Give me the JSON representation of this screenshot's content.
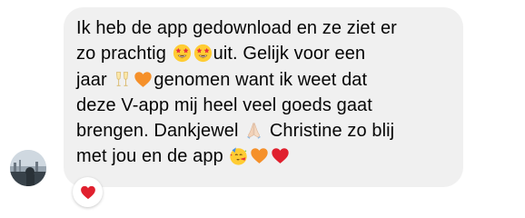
{
  "message": {
    "lines": {
      "l1": "Ik heb de app gedownload en ze ziet er",
      "l2a": "zo prachtig ",
      "l2b": "uit. Gelijk voor een",
      "l3a": "jaar ",
      "l3b": "genomen want ik weet dat",
      "l4": "deze V-app mij heel veel goeds gaat",
      "l5a": "brengen. Dankjewel ",
      "l5b": " Christine zo blij",
      "l6": "met jou en de app "
    },
    "emojis": [
      "star-struck",
      "star-struck",
      "clinking-glasses",
      "orange-heart",
      "folded-hands",
      "partying-face",
      "orange-heart",
      "red-heart"
    ]
  },
  "reaction": {
    "emoji": "red-heart"
  },
  "colors": {
    "bubble": "#f0f0f0",
    "text": "#050505",
    "heart_red": "#e0202e",
    "heart_orange": "#f5902a"
  }
}
